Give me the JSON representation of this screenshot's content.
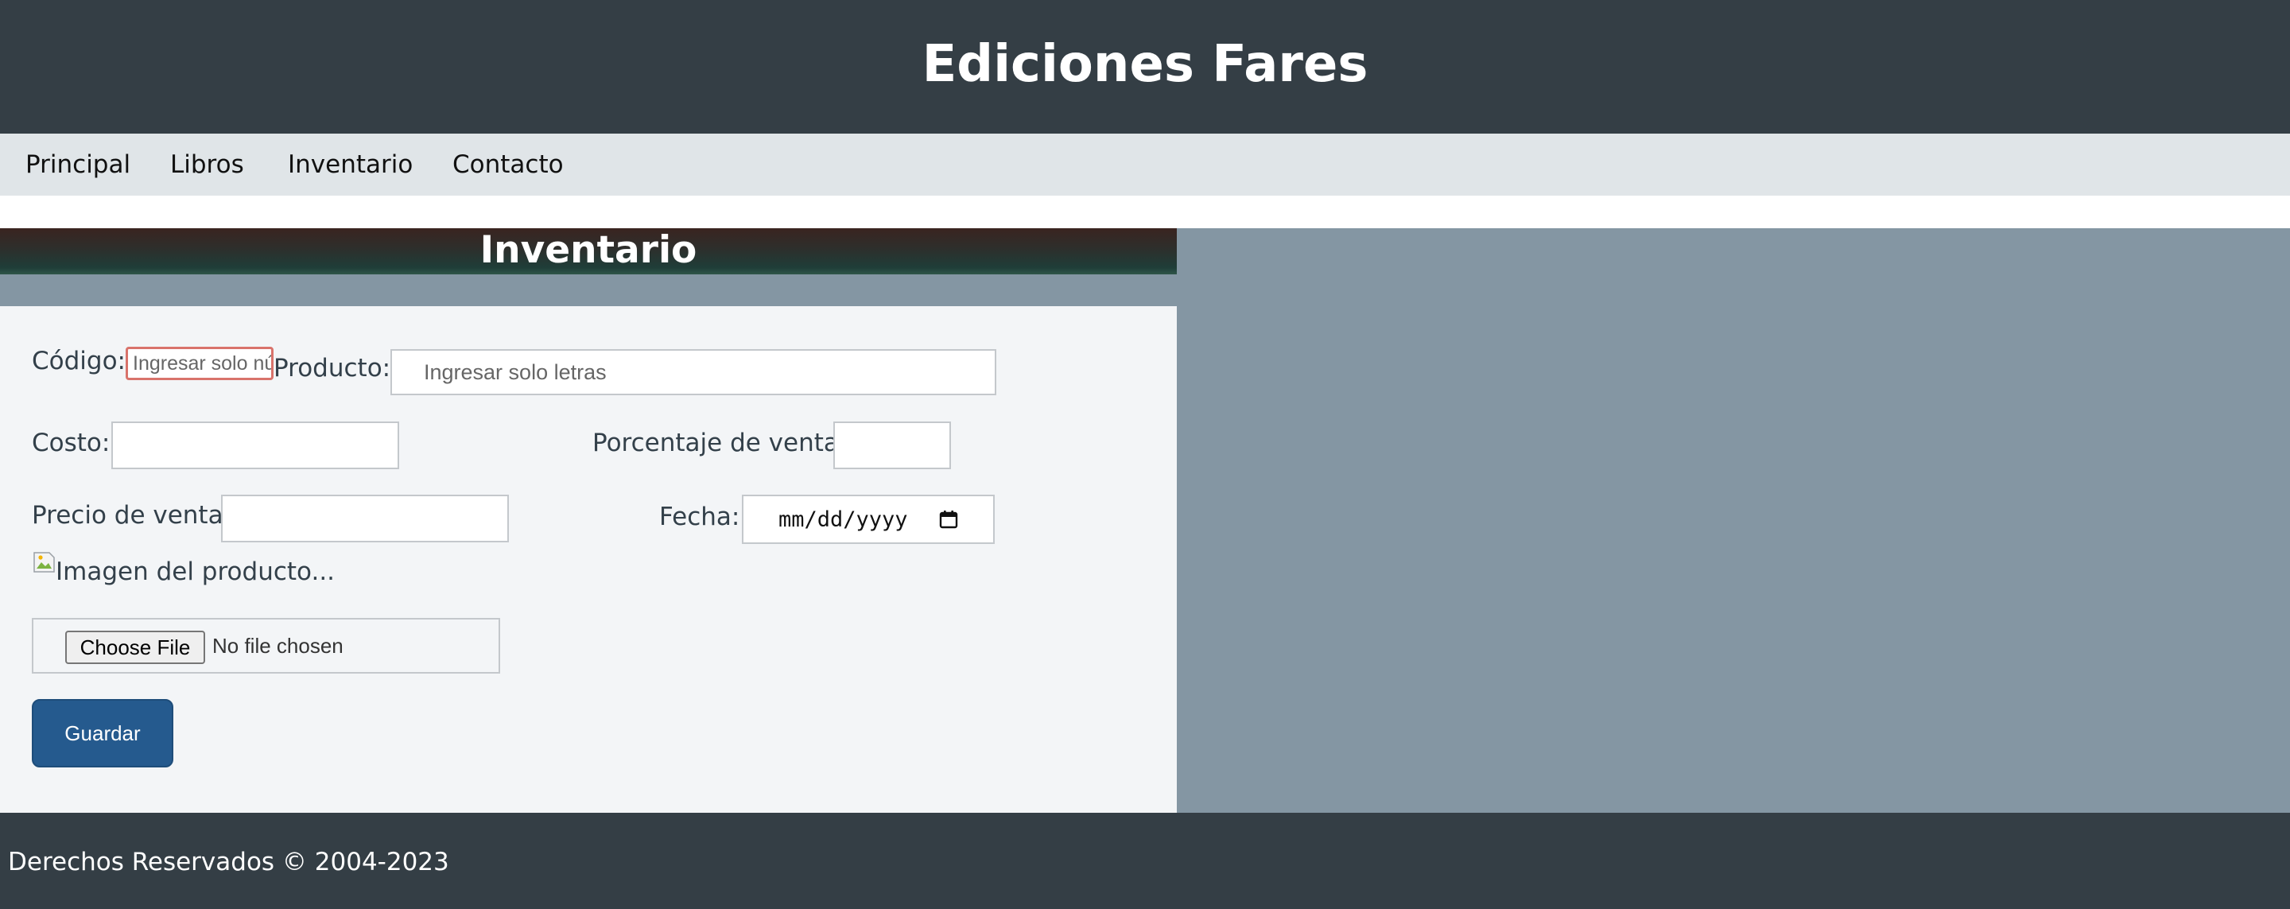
{
  "header": {
    "title": "Ediciones Fares"
  },
  "nav": {
    "items": [
      {
        "label": "Principal"
      },
      {
        "label": "Libros"
      },
      {
        "label": "Inventario"
      },
      {
        "label": "Contacto"
      }
    ]
  },
  "inventory": {
    "title": "Inventario",
    "form": {
      "codigo_label": "Código:",
      "codigo_placeholder": "Ingresar solo números",
      "codigo_value": "",
      "producto_label": "Producto:",
      "producto_placeholder": "Ingresar solo letras",
      "producto_value": "",
      "costo_label": "Costo:",
      "costo_value": "",
      "porcentaje_label": "Porcentaje de venta:",
      "porcentaje_value": "",
      "precio_label": "Precio de venta:",
      "precio_value": "",
      "fecha_label": "Fecha:",
      "fecha_value": "mm/dd/yyyy",
      "imagen_alt": "Imagen del producto...",
      "file_button_label": "Choose File",
      "file_status": "No file chosen",
      "save_label": "Guardar"
    }
  },
  "footer": {
    "text": "Derechos Reservados © 2004-2023"
  },
  "colors": {
    "header_bg": "#343e45",
    "nav_bg": "#e0e5e8",
    "panel_bg": "#8496a3",
    "form_bg": "#f3f5f7",
    "save_button": "#255a8e",
    "codigo_border_error": "#d9736b"
  },
  "icons": {
    "calendar": "calendar-icon",
    "broken_image": "broken-image-icon"
  }
}
